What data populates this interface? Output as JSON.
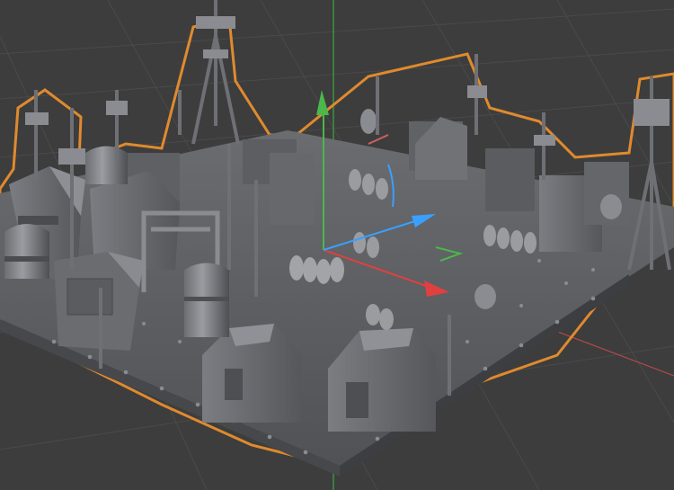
{
  "viewport": {
    "background": "#3d3d3d",
    "grid_color": "#4a4a4a",
    "selection_outline": "#e08a2e",
    "axis_x_color": "#d94a4a",
    "axis_y_color": "#4fb84a",
    "axis_z_color": "#4a7fe0",
    "gizmo_x_color": "#e04040",
    "gizmo_y_color": "#4ab84a",
    "gizmo_z_color": "#3aa0ff",
    "model_base": "#5e6063",
    "model_light": "#80828a",
    "model_dark": "#3f4144",
    "object_type": "sci-fi city kitbash mesh (selected)",
    "gizmo_type": "translate-gizmo"
  }
}
